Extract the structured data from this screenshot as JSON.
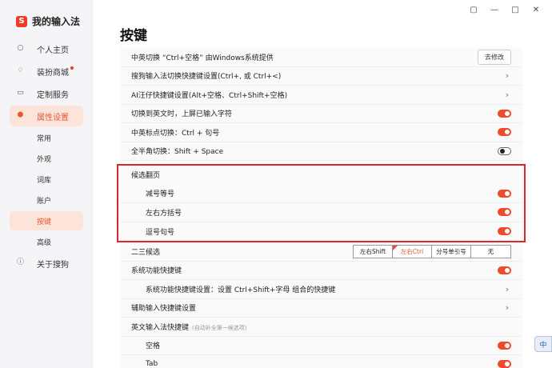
{
  "app": {
    "logo_char": "S",
    "name": "我的输入法"
  },
  "titlebar_icons": [
    "feedback-icon",
    "minimize-icon",
    "maximize-icon",
    "close-icon"
  ],
  "sidebar": {
    "items": [
      {
        "label": "个人主页",
        "icon": "user-icon"
      },
      {
        "label": "装扮商城",
        "icon": "shirt-icon",
        "dot": true
      },
      {
        "label": "定制服务",
        "icon": "box-icon"
      },
      {
        "label": "属性设置",
        "icon": "settings-hexagon-icon",
        "active": true
      }
    ],
    "sub_items": [
      {
        "label": "常用"
      },
      {
        "label": "外观"
      },
      {
        "label": "词库"
      },
      {
        "label": "账户"
      },
      {
        "label": "按键",
        "active": true
      },
      {
        "label": "高级"
      }
    ],
    "about": {
      "label": "关于搜狗",
      "icon": "info-icon"
    }
  },
  "page": {
    "title": "按键"
  },
  "settings": {
    "cn_en_switch": {
      "label": "中英切换 “Ctrl+空格” 由Windows系统提供",
      "button": "去修改"
    },
    "switch_shortcut": {
      "label": "搜狗输入法切换快捷键设置(Ctrl+, 或 Ctrl+<)"
    },
    "ai_shortcut": {
      "label": "AI汪仔快捷键设置(Alt+空格、Ctrl+Shift+空格)"
    },
    "english_commit": {
      "label": "切换到英文时，上屏已输入字符",
      "on": true
    },
    "punct_switch": {
      "label": "中英标点切换：Ctrl + 句号",
      "on": true
    },
    "width_switch": {
      "label": "全半角切换：Shift + Space",
      "on": false
    },
    "candidate_paging": {
      "title": "候选翻页",
      "items": [
        {
          "label": "减号等号",
          "on": true
        },
        {
          "label": "左右方括号",
          "on": true
        },
        {
          "label": "逗号句号",
          "on": true
        }
      ]
    },
    "second_third": {
      "label": "二三候选",
      "options": [
        "左右Shift",
        "左右Ctrl",
        "分号单引号",
        "无"
      ],
      "selected": "左右Ctrl"
    },
    "system_shortcut": {
      "label": "系统功能快捷键",
      "on": true
    },
    "system_shortcut_setting": {
      "label": "系统功能快捷键设置：设置 Ctrl+Shift+字母 组合的快捷键"
    },
    "assist_shortcut": {
      "label": "辅助输入快捷键设置"
    },
    "en_shortcut": {
      "label": "英文输入法快捷键",
      "hint": "(自动补全第一候选项)",
      "items": [
        {
          "label": "空格",
          "on": true
        },
        {
          "label": "Tab",
          "on": true
        }
      ]
    }
  },
  "float_badge": {
    "label": "中"
  }
}
